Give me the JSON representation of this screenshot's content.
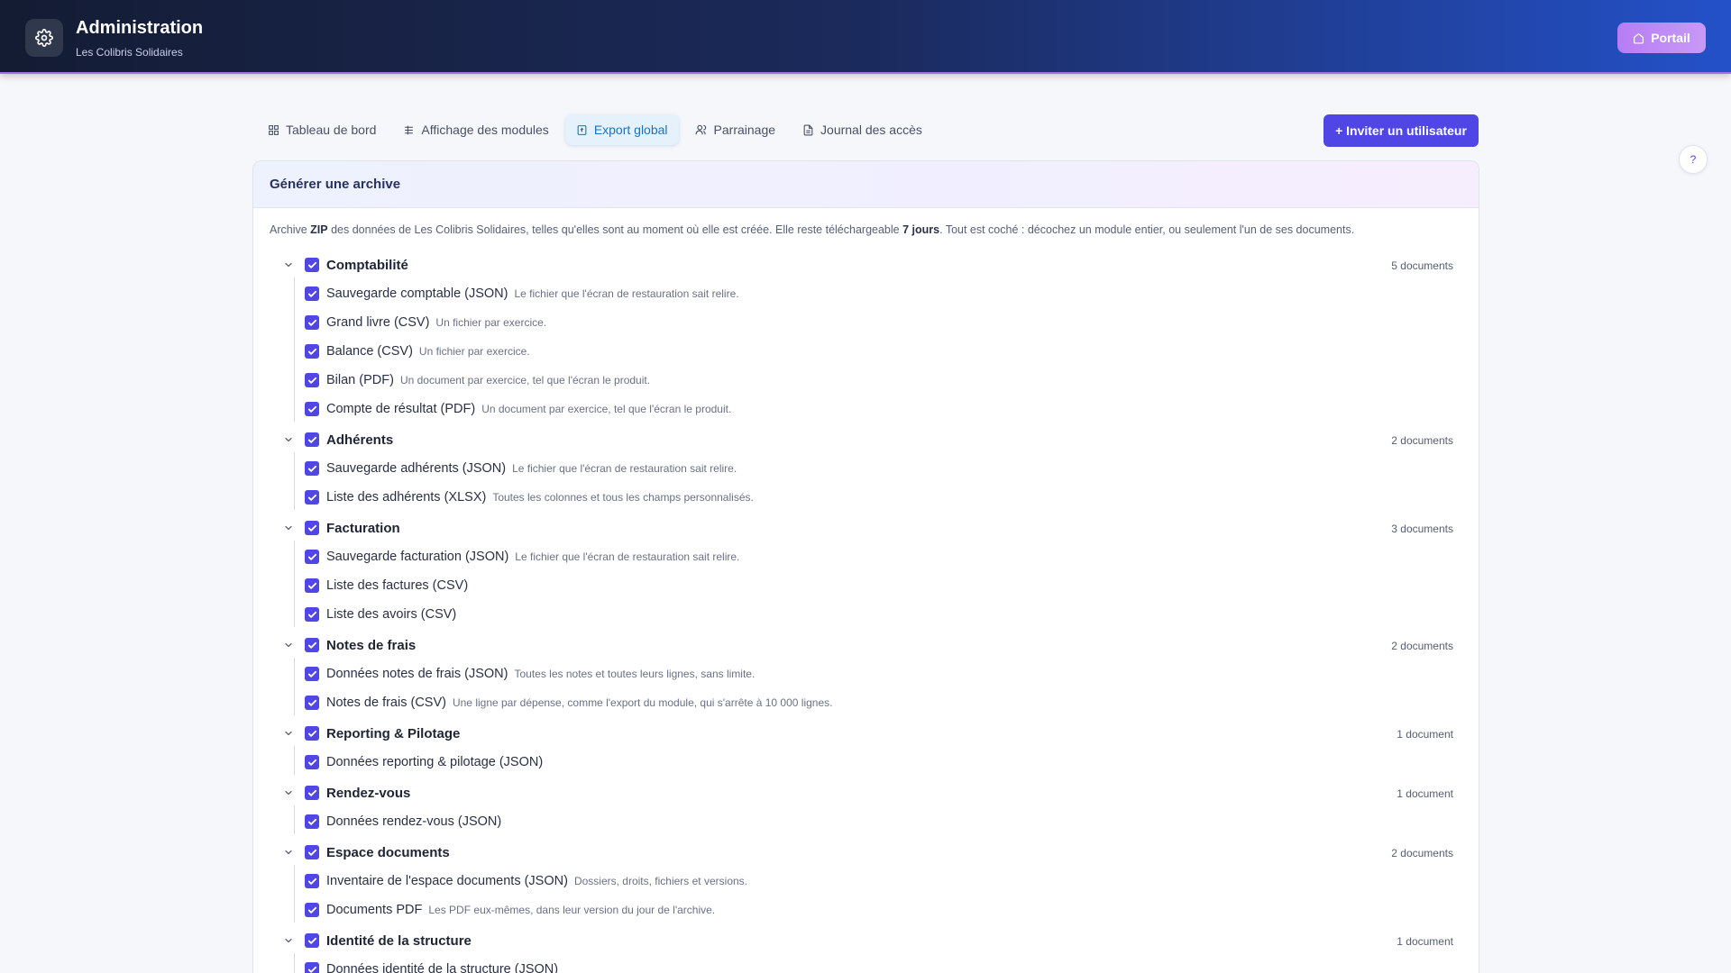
{
  "header": {
    "title": "Administration",
    "subtitle": "Les Colibris Solidaires",
    "portal_label": "Portail",
    "icon": "gear-icon",
    "portal_icon": "home-icon"
  },
  "tabs": [
    {
      "label": "Tableau de bord",
      "icon": "dashboard-icon"
    },
    {
      "label": "Affichage des modules",
      "icon": "modules-list-icon"
    },
    {
      "label": "Export global",
      "icon": "archive-icon",
      "active": true
    },
    {
      "label": "Parrainage",
      "icon": "users-icon"
    },
    {
      "label": "Journal des accès",
      "icon": "file-text-icon"
    }
  ],
  "invite_label": "+ Inviter un utilisateur",
  "help_label": "?",
  "card": {
    "title": "Générer une archive",
    "desc": {
      "p1": "Archive ",
      "zip": "ZIP",
      "p2": " des données de Les Colibris Solidaires, telles qu'elles sont au moment où elle est créée. Elle reste téléchargeable ",
      "days": "7 jours",
      "p3": ". Tout est coché : décochez un module entier, ou seulement l'un de ses documents."
    }
  },
  "modules": [
    {
      "name": "Comptabilité",
      "count": "5 documents",
      "docs": [
        {
          "label": "Sauvegarde comptable (JSON)",
          "note": "Le fichier que l'écran de restauration sait relire."
        },
        {
          "label": "Grand livre (CSV)",
          "note": "Un fichier par exercice."
        },
        {
          "label": "Balance (CSV)",
          "note": "Un fichier par exercice."
        },
        {
          "label": "Bilan (PDF)",
          "note": "Un document par exercice, tel que l'écran le produit."
        },
        {
          "label": "Compte de résultat (PDF)",
          "note": "Un document par exercice, tel que l'écran le produit."
        }
      ]
    },
    {
      "name": "Adhérents",
      "count": "2 documents",
      "docs": [
        {
          "label": "Sauvegarde adhérents (JSON)",
          "note": "Le fichier que l'écran de restauration sait relire."
        },
        {
          "label": "Liste des adhérents (XLSX)",
          "note": "Toutes les colonnes et tous les champs personnalisés."
        }
      ]
    },
    {
      "name": "Facturation",
      "count": "3 documents",
      "docs": [
        {
          "label": "Sauvegarde facturation (JSON)",
          "note": "Le fichier que l'écran de restauration sait relire."
        },
        {
          "label": "Liste des factures (CSV)",
          "note": ""
        },
        {
          "label": "Liste des avoirs (CSV)",
          "note": ""
        }
      ]
    },
    {
      "name": "Notes de frais",
      "count": "2 documents",
      "docs": [
        {
          "label": "Données notes de frais (JSON)",
          "note": "Toutes les notes et toutes leurs lignes, sans limite."
        },
        {
          "label": "Notes de frais (CSV)",
          "note": "Une ligne par dépense, comme l'export du module, qui s'arrête à 10 000 lignes."
        }
      ]
    },
    {
      "name": "Reporting & Pilotage",
      "count": "1 document",
      "docs": [
        {
          "label": "Données reporting & pilotage (JSON)",
          "note": ""
        }
      ]
    },
    {
      "name": "Rendez-vous",
      "count": "1 document",
      "docs": [
        {
          "label": "Données rendez-vous (JSON)",
          "note": ""
        }
      ]
    },
    {
      "name": "Espace documents",
      "count": "2 documents",
      "docs": [
        {
          "label": "Inventaire de l'espace documents (JSON)",
          "note": "Dossiers, droits, fichiers et versions."
        },
        {
          "label": "Documents PDF",
          "note": "Les PDF eux-mêmes, dans leur version du jour de l'archive."
        }
      ]
    },
    {
      "name": "Identité de la structure",
      "count": "1 document",
      "docs": [
        {
          "label": "Données identité de la structure (JSON)",
          "note": ""
        }
      ]
    }
  ],
  "colors": {
    "accent": "#4f46e5",
    "header_start": "#141c33",
    "header_end": "#2451c9",
    "portal": "#b77cf4"
  }
}
